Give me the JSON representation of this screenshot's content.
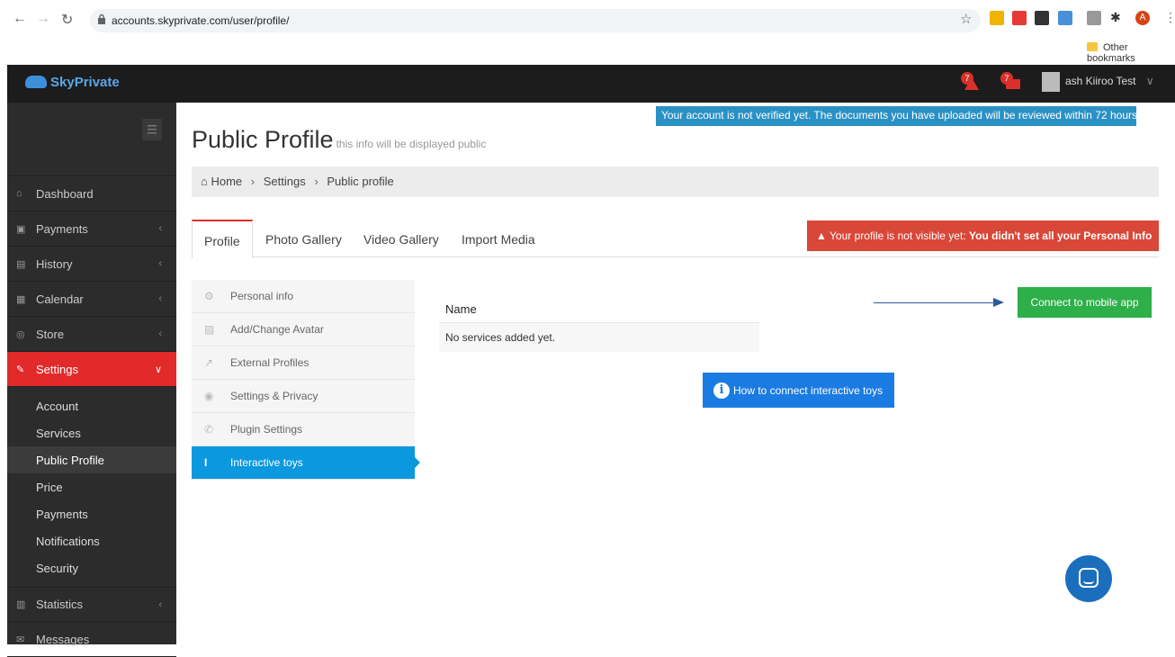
{
  "browser": {
    "url": "accounts.skyprivate.com/user/profile/",
    "bookmark_folder": "Other bookmarks",
    "ext_colors": [
      "#f2b200",
      "#e53935",
      "#333333",
      "#4a90d9",
      "#888888",
      "#333333",
      "#d84315"
    ]
  },
  "topbar": {
    "logo": "SkyPrivate",
    "notif_count_1": "7",
    "notif_count_2": "7",
    "user_name": "ash Kiiroo Test",
    "user_chevron": "∨"
  },
  "sidebar": {
    "items": [
      {
        "label": "Dashboard",
        "icon": "home-icon",
        "glyph": "⌂"
      },
      {
        "label": "Payments",
        "icon": "money-icon",
        "glyph": "▣"
      },
      {
        "label": "History",
        "icon": "book-icon",
        "glyph": "▤"
      },
      {
        "label": "Calendar",
        "icon": "calendar-icon",
        "glyph": "▦"
      },
      {
        "label": "Store",
        "icon": "store-icon",
        "glyph": "◎"
      },
      {
        "label": "Settings",
        "icon": "wrench-icon",
        "glyph": "✎"
      }
    ],
    "sub_items": [
      "Account",
      "Services",
      "Public Profile",
      "Price",
      "Payments",
      "Notifications",
      "Security"
    ],
    "bottom_items": [
      {
        "label": "Statistics",
        "icon": "bar-chart-icon",
        "glyph": "▥"
      },
      {
        "label": "Messages",
        "icon": "envelope-icon",
        "glyph": "✉"
      }
    ],
    "chevron": "‹",
    "chevron_open": "∨"
  },
  "notice": "Your account is not verified yet. The documents you have uploaded will be reviewed within 72 hours.",
  "page": {
    "title": "Public Profile",
    "subtitle": "this info will be displayed public"
  },
  "breadcrumb": {
    "home_glyph": "⌂",
    "items": [
      "Home",
      "Settings",
      "Public profile"
    ],
    "sep": "›"
  },
  "tabs": [
    "Profile",
    "Photo Gallery",
    "Video Gallery",
    "Import Media"
  ],
  "visibility_alert": {
    "glyph": "▲",
    "prefix": "Your profile is not visible yet:",
    "bold": "You didn't set all your Personal Info"
  },
  "profile_menu": [
    {
      "label": "Personal info",
      "icon": "gear-icon",
      "glyph": "⚙"
    },
    {
      "label": "Add/Change Avatar",
      "icon": "image-icon",
      "glyph": "▨"
    },
    {
      "label": "External Profiles",
      "icon": "external-link-icon",
      "glyph": "↗"
    },
    {
      "label": "Settings & Privacy",
      "icon": "eye-icon",
      "glyph": "◉"
    },
    {
      "label": "Plugin Settings",
      "icon": "phone-icon",
      "glyph": "✆"
    },
    {
      "label": "Interactive toys",
      "icon": "toy-icon",
      "glyph": "I"
    }
  ],
  "services_table": {
    "header": "Name",
    "empty": "No services added yet."
  },
  "buttons": {
    "connect": "Connect to mobile app",
    "howto": "How to connect interactive toys",
    "howto_glyph": "i"
  },
  "colors": {
    "accent_red": "#e22a2a",
    "notice_blue": "#2a91c5",
    "connect_green": "#2eaf4a",
    "howto_blue": "#1a7ce2",
    "active_blue": "#0b98de"
  }
}
